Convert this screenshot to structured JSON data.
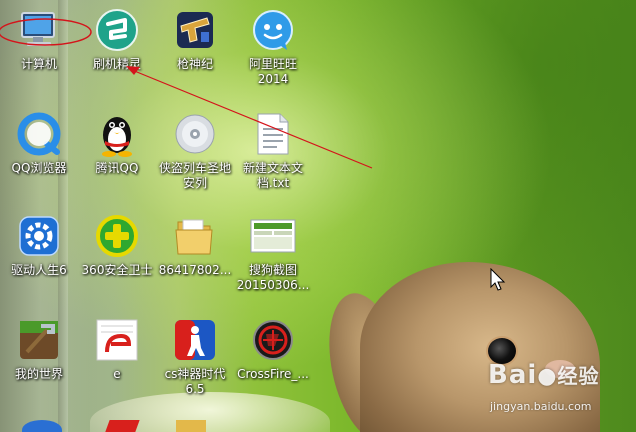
{
  "desktop": {
    "icons": [
      {
        "label": "计算机",
        "icon": "computer-icon"
      },
      {
        "label": "刷机精灵",
        "icon": "flash-elf-icon"
      },
      {
        "label": "枪神纪",
        "icon": "gun-game-icon"
      },
      {
        "label": "阿里旺旺\n2014",
        "icon": "aliwangwang-icon"
      },
      {
        "label": "QQ浏览器",
        "icon": "qq-browser-icon"
      },
      {
        "label": "腾讯QQ",
        "icon": "qq-penguin-icon"
      },
      {
        "label": "侠盗列车圣地\n安列",
        "icon": "disc-icon"
      },
      {
        "label": "新建文本文\n档.txt",
        "icon": "text-file-icon"
      },
      {
        "label": "驱动人生6",
        "icon": "driver-gear-icon"
      },
      {
        "label": "360安全卫士",
        "icon": "360-security-icon"
      },
      {
        "label": "86417802...",
        "icon": "folder-icon"
      },
      {
        "label": "搜狗截图\n20150306...",
        "icon": "screenshot-image-icon"
      },
      {
        "label": "我的世界",
        "icon": "minecraft-icon"
      },
      {
        "label": "e",
        "icon": "e-app-icon"
      },
      {
        "label": "cs神器时代\n6.5",
        "icon": "cs-game-icon"
      },
      {
        "label": "CrossFire_...",
        "icon": "crossfire-icon"
      }
    ]
  },
  "watermark": {
    "main": "Bai",
    "accent": "经验",
    "sub": "jingyan.baidu.com"
  },
  "colors": {
    "annotation_red": "#d4141b",
    "label_text": "#ffffff"
  }
}
